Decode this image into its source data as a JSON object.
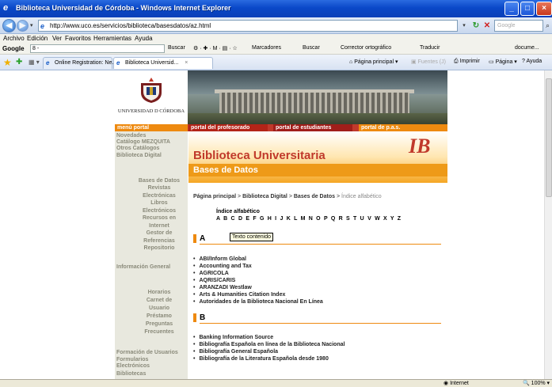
{
  "window": {
    "title": "Biblioteca Universidad de Córdoba - Windows Internet Explorer"
  },
  "address": {
    "url": "http://www.uco.es/servicios/biblioteca/basesdatos/az.html",
    "search_placeholder": "Google"
  },
  "menu": [
    "Archivo",
    "Edición",
    "Ver",
    "Favoritos",
    "Herramientas",
    "Ayuda"
  ],
  "google_toolbar": {
    "label": "Google",
    "box_value": "8 -",
    "items": [
      "Buscar",
      "Marcadores",
      "Buscar",
      "Corrector ortográfico",
      "Traducir",
      "docume..."
    ]
  },
  "tabs": [
    {
      "label": "Online Registration: Ne...",
      "active": false
    },
    {
      "label": "Biblioteca Universid...",
      "active": true
    }
  ],
  "commands": {
    "home": "Página principal",
    "feeds": "Fuentes (J)",
    "print": "Imprimir",
    "page": "Página",
    "help": "Ayuda"
  },
  "site": {
    "logo_text": "UNIVERSIDAD D CÓRDOBA",
    "nav": [
      "menú portal",
      "portal del profesorado",
      "portal de estudiantes",
      "portal de p.a.s."
    ],
    "sidebar": [
      {
        "label": "Novedades"
      },
      {
        "label": "Catálogo MEZQUITA"
      },
      {
        "label": "Otros Catálogos"
      },
      {
        "label": "Biblioteca Digital"
      },
      {
        "label": "Bases de Datos"
      },
      {
        "label": "Revistas"
      },
      {
        "label": "Electrónicas"
      },
      {
        "label": "Libros"
      },
      {
        "label": "Electrónicos"
      },
      {
        "label": "Recursos en"
      },
      {
        "label": "Internet"
      },
      {
        "label": "Gestor de"
      },
      {
        "label": "Referencias"
      },
      {
        "label": "Repositorio"
      },
      {
        "label": "Información General"
      },
      {
        "label": "Horarios"
      },
      {
        "label": "Carnet de"
      },
      {
        "label": "Usuario"
      },
      {
        "label": "Préstamo"
      },
      {
        "label": "Preguntas"
      },
      {
        "label": "Frecuentes"
      },
      {
        "label": "Formación de Usuarios"
      },
      {
        "label": "Formularios"
      },
      {
        "label": "Electrónicos"
      },
      {
        "label": "Bibliotecas"
      }
    ],
    "header_title": "Biblioteca Universitaria",
    "header_sub": "Bases de Datos",
    "emblem": "IB",
    "breadcrumb": {
      "home": "Página principal",
      "digital": "Biblioteca Digital",
      "db": "Bases de Datos",
      "current": "Índice alfabético",
      "sep": ">"
    },
    "alpha_title": "Índice alfabético",
    "alpha_letters": "A B C D E F G H I J K L M N O P Q R S T U V W X Y Z",
    "section_a": "A",
    "list_a": [
      "ABI/Inform Global",
      "Accounting and Tax",
      "AGRICOLA",
      "AQRIS/CARIS",
      "ARANZADI Westlaw",
      "Arts & Humanities Citation Index",
      "Autoridades de la Biblioteca Nacional En Línea"
    ],
    "section_b": "B",
    "list_b": [
      "Banking Information Source",
      "Bibliografía Española en línea de la Biblioteca Nacional",
      "Bibliografía General Española",
      "Bibliografía de la Literatura Española desde 1980"
    ],
    "tooltip": "Texto contenido"
  },
  "status": {
    "zone": "Internet",
    "zoom": "100%"
  }
}
